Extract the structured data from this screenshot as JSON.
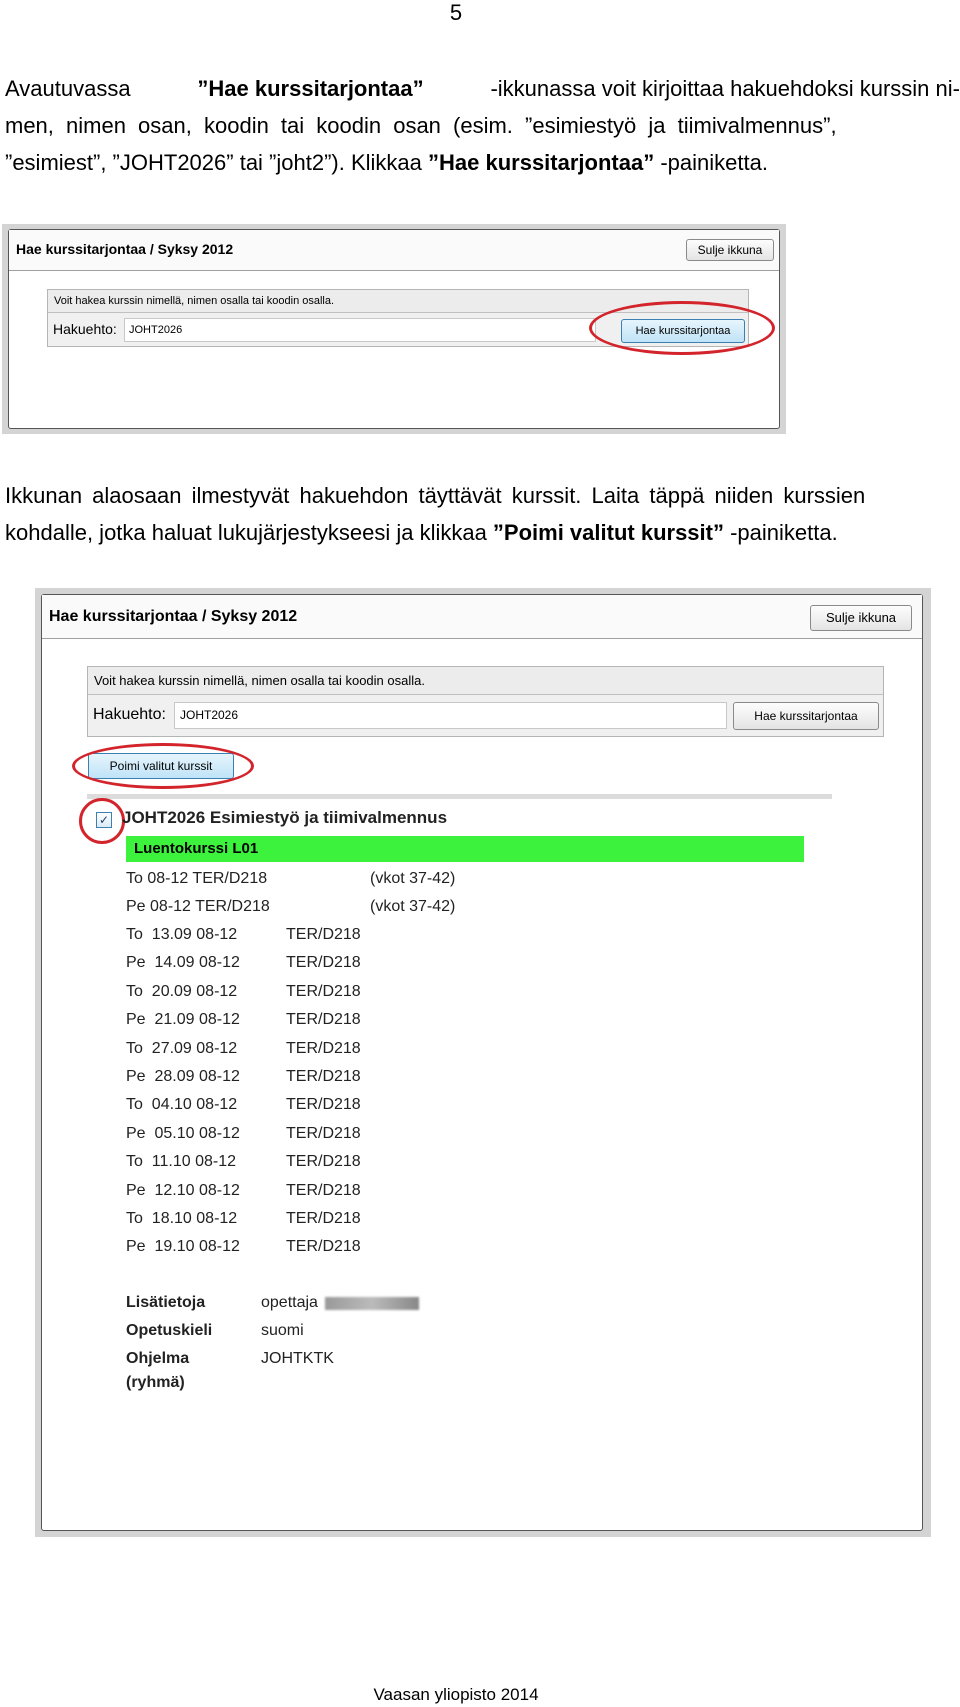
{
  "page_number": "5",
  "intro": {
    "l1": [
      "Avautuvassa ",
      "”Hae kurssitarjontaa”",
      " -ikkunassa voit kirjoittaa hakuehdoksi kurssin ni-"
    ],
    "l2": "men, nimen osan, koodin tai koodin osan (esim. ”esimiestyö ja tiimivalmennus”,",
    "l3": [
      "”esimiest”, ”JOHT2026” tai ”joht2”). Klikkaa ",
      "”Hae kurssitarjontaa”",
      " -painiketta."
    ]
  },
  "window": {
    "title": "Hae kurssitarjontaa / Syksy 2012",
    "close_label": "Sulje ikkuna",
    "info": "Voit hakea kurssin nimellä, nimen osalla tai koodin osalla.",
    "search_label": "Hakuehto:",
    "search_value": "JOHT2026",
    "search_button": "Hae kurssitarjontaa",
    "pick_button": "Poimi valitut kurssit"
  },
  "middle": {
    "l1": "Ikkunan alaosaan ilmestyvät hakuehdon täyttävät kurssit. Laita täppä niiden kurssien",
    "l2": [
      "kohdalle, jotka haluat lukujärjestykseesi ja klikkaa ",
      "”Poimi valitut kurssit”",
      " -painiketta."
    ]
  },
  "course": {
    "checked": true,
    "title": "JOHT2026 Esimiestyö ja tiimivalmennus",
    "group_header": "Luentokurssi L01",
    "group_color": "#3cf23c",
    "weekly": [
      {
        "day": "To 08-12 TER/D218",
        "weeks": "(vkot 37-42)"
      },
      {
        "day": "Pe 08-12 TER/D218",
        "weeks": "(vkot 37-42)"
      }
    ],
    "sessions": [
      {
        "date": "To  13.09 08-12",
        "room": "TER/D218"
      },
      {
        "date": "Pe  14.09 08-12",
        "room": "TER/D218"
      },
      {
        "date": "To  20.09 08-12",
        "room": "TER/D218"
      },
      {
        "date": "Pe  21.09 08-12",
        "room": "TER/D218"
      },
      {
        "date": "To  27.09 08-12",
        "room": "TER/D218"
      },
      {
        "date": "Pe  28.09 08-12",
        "room": "TER/D218"
      },
      {
        "date": "To  04.10 08-12",
        "room": "TER/D218"
      },
      {
        "date": "Pe  05.10 08-12",
        "room": "TER/D218"
      },
      {
        "date": "To  11.10 08-12",
        "room": "TER/D218"
      },
      {
        "date": "Pe  12.10 08-12",
        "room": "TER/D218"
      },
      {
        "date": "To  18.10 08-12",
        "room": "TER/D218"
      },
      {
        "date": "Pe  19.10 08-12",
        "room": "TER/D218"
      }
    ],
    "info": [
      {
        "label": "Lisätietoja",
        "value": "opettaja"
      },
      {
        "label": "Opetuskieli",
        "value": "suomi"
      },
      {
        "label": "Ohjelma (ryhmä)",
        "value": "JOHTKTK"
      }
    ]
  },
  "footer": "Vaasan yliopisto 2014"
}
